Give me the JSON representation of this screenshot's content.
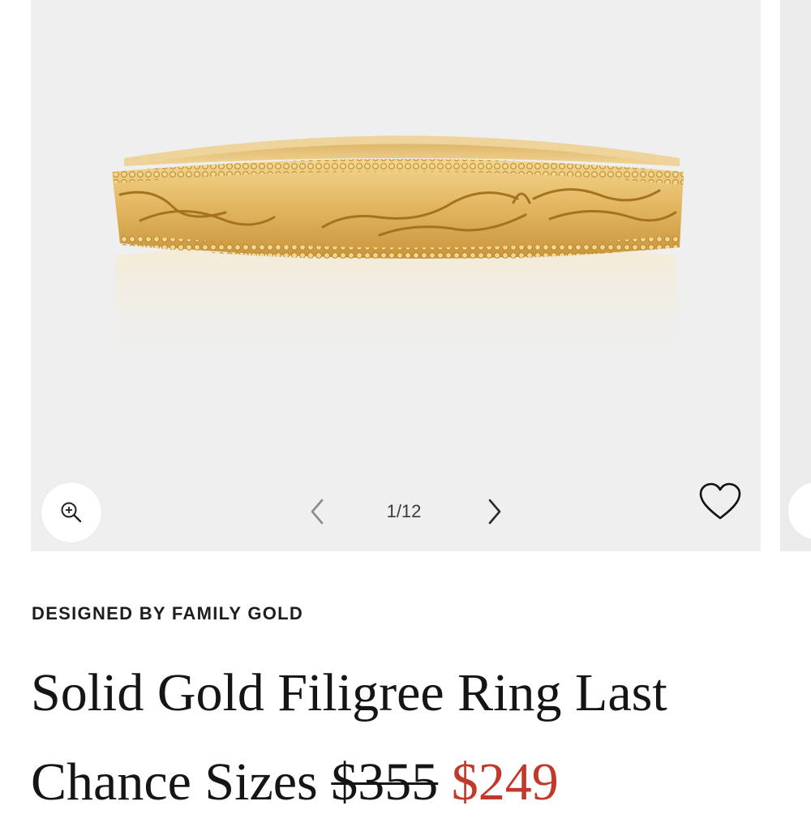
{
  "gallery": {
    "image_alt": "Solid gold ring with engraved filigree scroll pattern and beaded milgrain edges",
    "counter": "1/12",
    "icons": {
      "zoom": "zoom-in-icon",
      "prev": "chevron-left-icon",
      "next": "chevron-right-icon",
      "wishlist": "heart-outline-icon"
    }
  },
  "product": {
    "designer": "DESIGNED BY FAMILY GOLD",
    "title": "Solid Gold Filigree Ring Last Chance Sizes",
    "original_price": "$355",
    "sale_price": "$249"
  },
  "colors": {
    "gallery_bg": "#efefef",
    "gold": "#d9ab52",
    "sale": "#c0392b",
    "text": "#151515"
  }
}
